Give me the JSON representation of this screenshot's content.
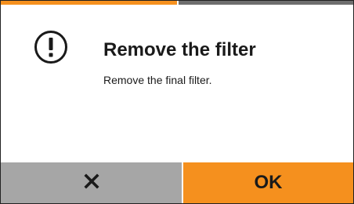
{
  "progress": {
    "fraction_complete": 0.5,
    "done_color": "#f5901e",
    "remaining_color": "#6e6e6e"
  },
  "dialog": {
    "icon": "exclamation-circle-icon",
    "title": "Remove the filter",
    "message": "Remove the final filter."
  },
  "buttons": {
    "cancel": {
      "icon": "close-x-icon",
      "background": "#a6a6a6"
    },
    "ok": {
      "label": "OK",
      "background": "#f5901e"
    }
  }
}
